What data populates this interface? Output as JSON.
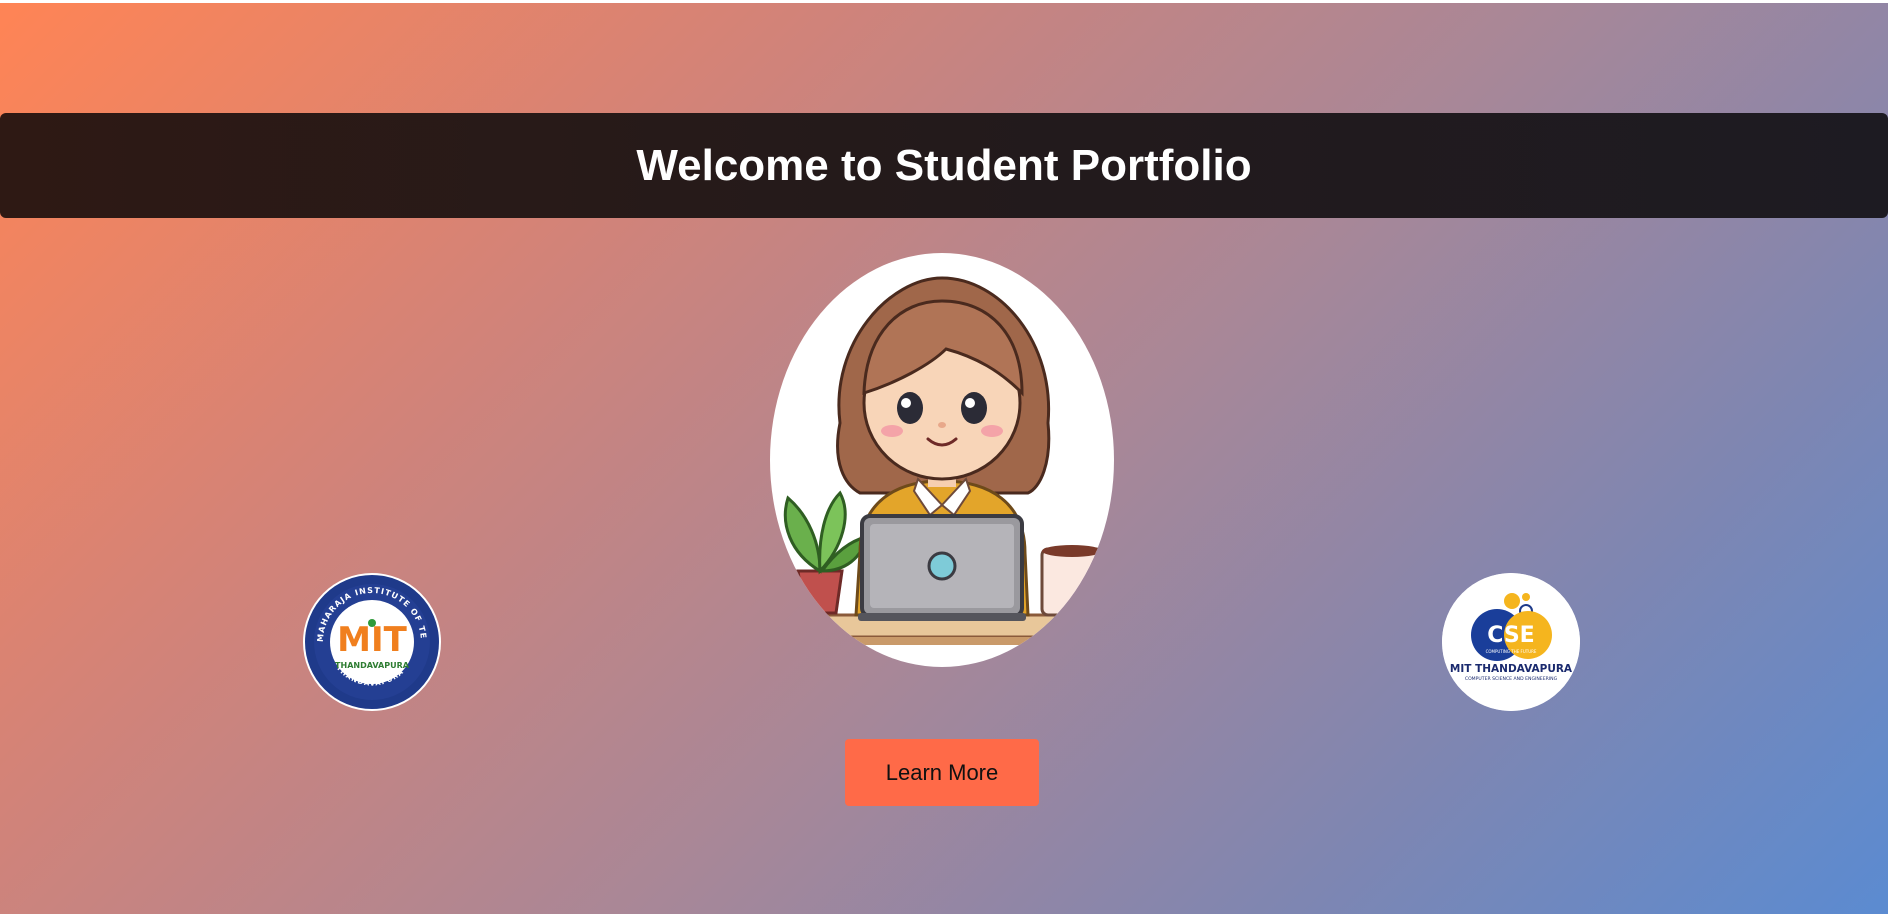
{
  "header": {
    "title": "Welcome to Student Portfolio"
  },
  "hero": {
    "image": "student-with-laptop-illustration"
  },
  "logos": {
    "left": {
      "name": "mit-thandavapura-logo",
      "monogram": "MIT",
      "ring_text": "MAHARAJA INSTITUTE OF TECHNOLOGY",
      "bottom_text": "THANDAVAPURA",
      "inner_text": "THANDAVAPURA"
    },
    "right": {
      "name": "cse-department-logo",
      "monogram": "CSE",
      "tagline": "COMPUTING THE FUTURE",
      "title": "MIT THANDAVAPURA",
      "subtitle": "COMPUTER SCIENCE AND ENGINEERING"
    }
  },
  "actions": {
    "learn_more_label": "Learn More"
  },
  "colors": {
    "gradient_start": "#ff8455",
    "gradient_end": "#5b8bd1",
    "banner": "#231a1b",
    "button": "#ff6a48"
  }
}
